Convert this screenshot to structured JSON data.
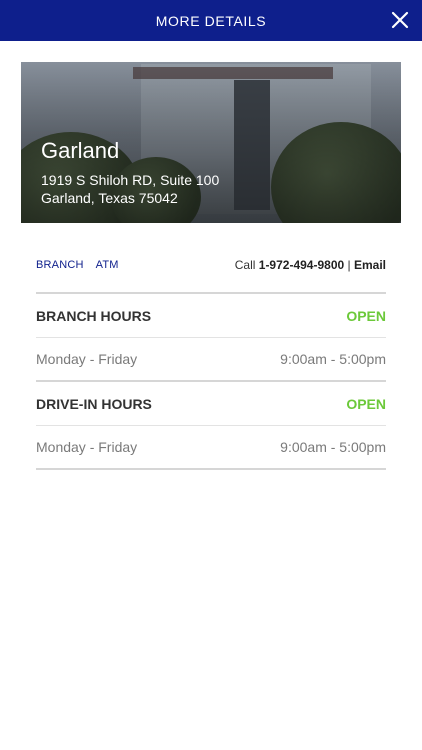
{
  "header": {
    "title": "MORE DETAILS",
    "close_icon": "close-icon",
    "background_color": "#0e1f8c"
  },
  "branch": {
    "name": "Garland",
    "address_line1": "1919 S Shiloh RD, Suite 100",
    "address_line2": "Garland, Texas 75042"
  },
  "tabs": [
    "BRANCH",
    "ATM"
  ],
  "contact": {
    "call_label": "Call",
    "phone": "1-972-494-9800",
    "separator": "|",
    "email_label": "Email"
  },
  "hours": [
    {
      "title": "BRANCH HOURS",
      "status": "OPEN",
      "days": "Monday - Friday",
      "time": "9:00am - 5:00pm"
    },
    {
      "title": "DRIVE-IN HOURS",
      "status": "OPEN",
      "days": "Monday - Friday",
      "time": "9:00am - 5:00pm"
    }
  ],
  "colors": {
    "accent": "#0e1f8c",
    "open_status": "#6cc93a"
  }
}
